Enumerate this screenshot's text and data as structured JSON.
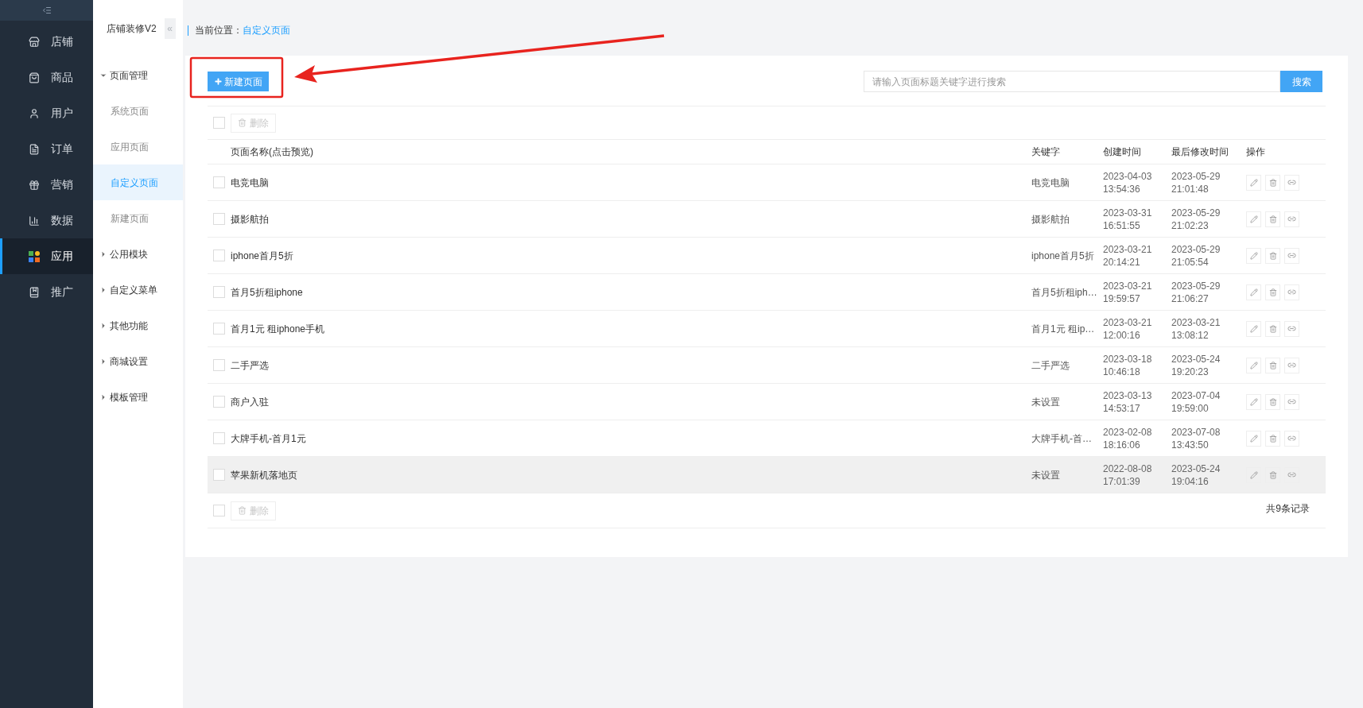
{
  "main_nav": {
    "items": [
      {
        "label": "店铺",
        "selected": false
      },
      {
        "label": "商品",
        "selected": false
      },
      {
        "label": "用户",
        "selected": false
      },
      {
        "label": "订单",
        "selected": false
      },
      {
        "label": "营销",
        "selected": false
      },
      {
        "label": "数据",
        "selected": false
      },
      {
        "label": "应用",
        "selected": true
      },
      {
        "label": "推广",
        "selected": false
      }
    ]
  },
  "sub_nav": {
    "title": "店铺装修V2",
    "collapse": "«",
    "groups": [
      {
        "label": "页面管理",
        "expanded": true,
        "children": [
          {
            "label": "系统页面",
            "selected": false
          },
          {
            "label": "应用页面",
            "selected": false
          },
          {
            "label": "自定义页面",
            "selected": true
          },
          {
            "label": "新建页面",
            "selected": false
          }
        ]
      },
      {
        "label": "公用模块",
        "expanded": false
      },
      {
        "label": "自定义菜单",
        "expanded": false
      },
      {
        "label": "其他功能",
        "expanded": false
      },
      {
        "label": "商城设置",
        "expanded": false
      },
      {
        "label": "模板管理",
        "expanded": false
      }
    ]
  },
  "breadcrumb": {
    "label": "当前位置：",
    "current": "自定义页面"
  },
  "toolbar": {
    "new_button": "新建页面",
    "search": {
      "placeholder": "请输入页面标题关键字进行搜索"
    },
    "search_button": "搜索"
  },
  "bulk_actions": {
    "checked": false,
    "delete_button": {
      "label": "删除",
      "disabled": true
    }
  },
  "table": {
    "columns": [
      "页面名称(点击预览)",
      "关键字",
      "创建时间",
      "最后修改时间",
      "操作"
    ],
    "rows": [
      {
        "name": "电竞电脑",
        "keyword": "电竞电脑",
        "created": [
          "2023-04-03",
          "13:54:36"
        ],
        "modified": [
          "2023-05-29",
          "21:01:48"
        ],
        "checked": false,
        "hovered": false
      },
      {
        "name": "摄影航拍",
        "keyword": "摄影航拍",
        "created": [
          "2023-03-31",
          "16:51:55"
        ],
        "modified": [
          "2023-05-29",
          "21:02:23"
        ],
        "checked": false,
        "hovered": false
      },
      {
        "name": "iphone首月5折",
        "keyword": "iphone首月5折",
        "created": [
          "2023-03-21",
          "20:14:21"
        ],
        "modified": [
          "2023-05-29",
          "21:05:54"
        ],
        "checked": false,
        "hovered": false
      },
      {
        "name": "首月5折租iphone",
        "keyword": "首月5折租iph…",
        "created": [
          "2023-03-21",
          "19:59:57"
        ],
        "modified": [
          "2023-05-29",
          "21:06:27"
        ],
        "checked": false,
        "hovered": false
      },
      {
        "name": "首月1元 租iphone手机",
        "keyword": "首月1元 租ip…",
        "created": [
          "2023-03-21",
          "12:00:16"
        ],
        "modified": [
          "2023-03-21",
          "13:08:12"
        ],
        "checked": false,
        "hovered": false
      },
      {
        "name": "二手严选",
        "keyword": "二手严选",
        "created": [
          "2023-03-18",
          "10:46:18"
        ],
        "modified": [
          "2023-05-24",
          "19:20:23"
        ],
        "checked": false,
        "hovered": false
      },
      {
        "name": "商户入驻",
        "keyword": "未设置",
        "created": [
          "2023-03-13",
          "14:53:17"
        ],
        "modified": [
          "2023-07-04",
          "19:59:00"
        ],
        "checked": false,
        "hovered": false
      },
      {
        "name": "大牌手机-首月1元",
        "keyword": "大牌手机-首…",
        "created": [
          "2023-02-08",
          "18:16:06"
        ],
        "modified": [
          "2023-07-08",
          "13:43:50"
        ],
        "checked": false,
        "hovered": false
      },
      {
        "name": "苹果新机落地页",
        "keyword": "未设置",
        "created": [
          "2022-08-08",
          "17:01:39"
        ],
        "modified": [
          "2023-05-24",
          "19:04:16"
        ],
        "checked": false,
        "hovered": true
      }
    ]
  },
  "footer": {
    "checked": false,
    "delete_button": {
      "label": "删除",
      "disabled": true
    },
    "total": "共9条记录"
  },
  "annotation": {
    "kind": "arrow-highlight"
  }
}
